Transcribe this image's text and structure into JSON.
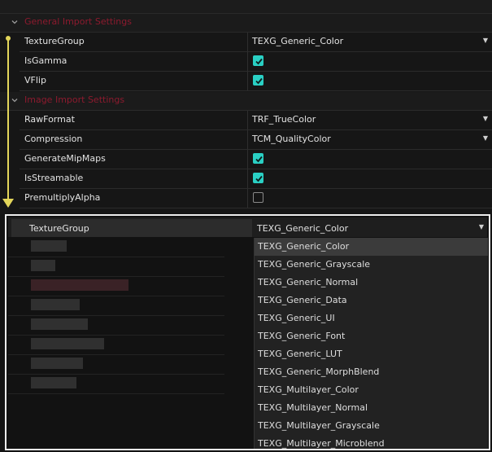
{
  "sections": [
    {
      "title": "General Import Settings",
      "rows": [
        {
          "label": "TextureGroup",
          "type": "dropdown",
          "value": "TEXG_Generic_Color"
        },
        {
          "label": "IsGamma",
          "type": "checkbox",
          "checked": true
        },
        {
          "label": "VFlip",
          "type": "checkbox",
          "checked": true
        }
      ]
    },
    {
      "title": "Image Import Settings",
      "rows": [
        {
          "label": "RawFormat",
          "type": "dropdown",
          "value": "TRF_TrueColor"
        },
        {
          "label": "Compression",
          "type": "dropdown",
          "value": "TCM_QualityColor"
        },
        {
          "label": "GenerateMipMaps",
          "type": "checkbox",
          "checked": true
        },
        {
          "label": "IsStreamable",
          "type": "checkbox",
          "checked": true
        },
        {
          "label": "PremultiplyAlpha",
          "type": "checkbox",
          "checked": false
        }
      ]
    }
  ],
  "zoom": {
    "label": "TextureGroup",
    "value": "TEXG_Generic_Color",
    "options": [
      "TEXG_Generic_Color",
      "TEXG_Generic_Grayscale",
      "TEXG_Generic_Normal",
      "TEXG_Generic_Data",
      "TEXG_Generic_UI",
      "TEXG_Generic_Font",
      "TEXG_Generic_LUT",
      "TEXG_Generic_MorphBlend",
      "TEXG_Multilayer_Color",
      "TEXG_Multilayer_Normal",
      "TEXG_Multilayer_Grayscale",
      "TEXG_Multilayer_Microblend"
    ],
    "selected_index": 0
  },
  "colors": {
    "section_title": "#8c1a2e",
    "checkbox_on": "#2ad0c4",
    "guide_arrow": "#e3d65a"
  }
}
